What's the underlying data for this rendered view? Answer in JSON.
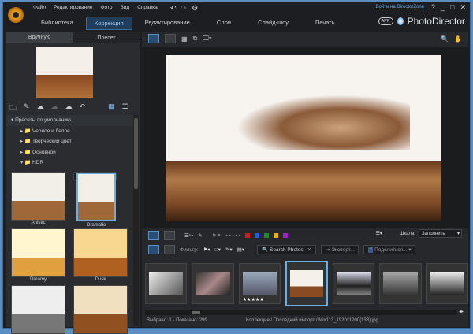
{
  "menu": [
    "Файл",
    "Редактирование",
    "Фото",
    "Вид",
    "Справка"
  ],
  "main_tabs": [
    "Библиотека",
    "Коррекция",
    "Редактирование",
    "Слои",
    "Слайд-шоу",
    "Печать"
  ],
  "login_link": "Войти на DirectorZone",
  "brand": {
    "app_badge": "APP",
    "name": "PhotoDirector"
  },
  "left_tabs": [
    "Вручную",
    "Пресет"
  ],
  "tree": {
    "root": "Пресеты по умолчанию",
    "items": [
      "Черное и белое",
      "Творческий цвет",
      "Основной",
      "HDR"
    ]
  },
  "presets": [
    "Artistic",
    "Dramatic",
    "Dreamy",
    "Dusk",
    "",
    ""
  ],
  "color_labels": [
    "#d01818",
    "#1f5fe0",
    "#1f8a2a",
    "#e8b010",
    "#9a22c8"
  ],
  "scale": {
    "label": "Шкала:",
    "value": "Заполнить"
  },
  "filter_label": "Фильтр:",
  "search_placeholder": "Search Photos",
  "export_label": "Экспорт...",
  "share_label": "Поделиться...",
  "rating_stars": "★★★★★",
  "status": {
    "selected": "Выбрано: 1 - Показано: 299",
    "path": "Коллекция / Последний импорт / Mix113_1920x1200(138).jpg"
  }
}
